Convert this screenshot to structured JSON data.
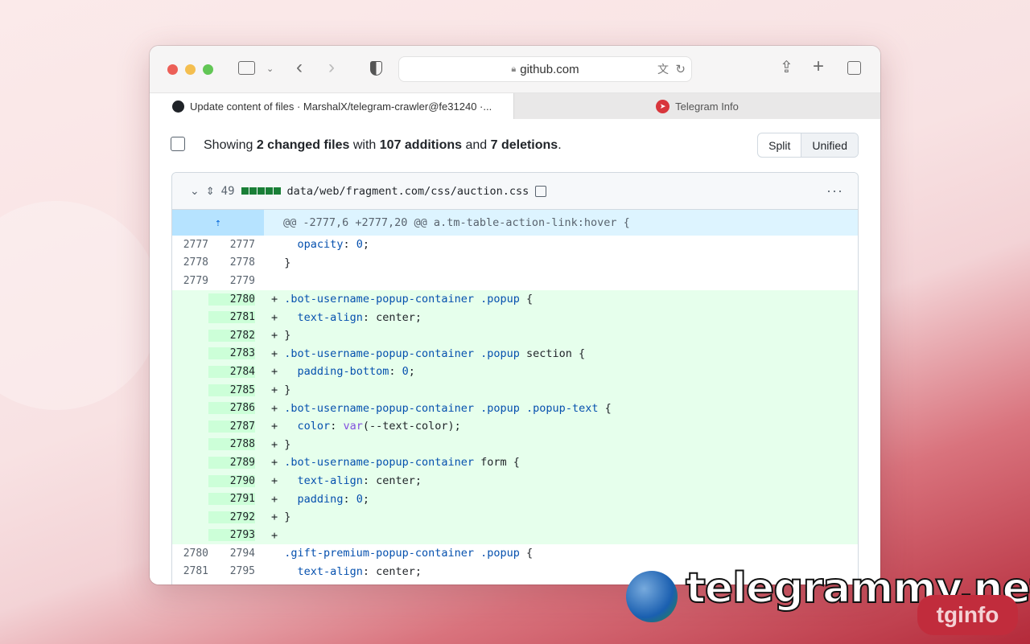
{
  "browser": {
    "url": "github.com",
    "tabs": [
      {
        "label": "Update content of files · MarshalX/telegram-crawler@fe31240 ·..."
      },
      {
        "label": "Telegram Info"
      }
    ]
  },
  "summary": {
    "prefix": "Showing ",
    "files": "2 changed files",
    "mid1": " with ",
    "additions": "107 additions",
    "mid2": " and ",
    "deletions": "7 deletions",
    "suffix": "."
  },
  "view_toggle": {
    "split": "Split",
    "unified": "Unified",
    "selected": "Unified"
  },
  "file": {
    "changes": "49",
    "path": "data/web/fragment.com/css/auction.css",
    "hunk": "@@ -2777,6 +2777,20 @@ a.tm-table-action-link:hover {"
  },
  "lines": [
    {
      "old": "2777",
      "new": "2777",
      "type": "ctx",
      "sign": " ",
      "tokens": [
        [
          "t",
          "  "
        ],
        [
          "p",
          "opacity"
        ],
        [
          "t",
          ": "
        ],
        [
          "n",
          "0"
        ],
        [
          "t",
          ";"
        ]
      ]
    },
    {
      "old": "2778",
      "new": "2778",
      "type": "ctx",
      "sign": " ",
      "tokens": [
        [
          "t",
          "}"
        ]
      ]
    },
    {
      "old": "2779",
      "new": "2779",
      "type": "ctx",
      "sign": " ",
      "tokens": []
    },
    {
      "old": "",
      "new": "2780",
      "type": "add",
      "sign": "+",
      "tokens": [
        [
          "s",
          ".bot-username-popup-container"
        ],
        [
          "t",
          " "
        ],
        [
          "s",
          ".popup"
        ],
        [
          "t",
          " {"
        ]
      ]
    },
    {
      "old": "",
      "new": "2781",
      "type": "add",
      "sign": "+",
      "tokens": [
        [
          "t",
          "  "
        ],
        [
          "p",
          "text-align"
        ],
        [
          "t",
          ": center;"
        ]
      ]
    },
    {
      "old": "",
      "new": "2782",
      "type": "add",
      "sign": "+",
      "tokens": [
        [
          "t",
          "}"
        ]
      ]
    },
    {
      "old": "",
      "new": "2783",
      "type": "add",
      "sign": "+",
      "tokens": [
        [
          "s",
          ".bot-username-popup-container"
        ],
        [
          "t",
          " "
        ],
        [
          "s",
          ".popup"
        ],
        [
          "t",
          " section {"
        ]
      ]
    },
    {
      "old": "",
      "new": "2784",
      "type": "add",
      "sign": "+",
      "tokens": [
        [
          "t",
          "  "
        ],
        [
          "p",
          "padding-bottom"
        ],
        [
          "t",
          ": "
        ],
        [
          "n",
          "0"
        ],
        [
          "t",
          ";"
        ]
      ]
    },
    {
      "old": "",
      "new": "2785",
      "type": "add",
      "sign": "+",
      "tokens": [
        [
          "t",
          "}"
        ]
      ]
    },
    {
      "old": "",
      "new": "2786",
      "type": "add",
      "sign": "+",
      "tokens": [
        [
          "s",
          ".bot-username-popup-container"
        ],
        [
          "t",
          " "
        ],
        [
          "s",
          ".popup"
        ],
        [
          "t",
          " "
        ],
        [
          "s",
          ".popup-text"
        ],
        [
          "t",
          " {"
        ]
      ]
    },
    {
      "old": "",
      "new": "2787",
      "type": "add",
      "sign": "+",
      "tokens": [
        [
          "t",
          "  "
        ],
        [
          "p",
          "color"
        ],
        [
          "t",
          ": "
        ],
        [
          "f",
          "var"
        ],
        [
          "t",
          "(--text-color);"
        ]
      ]
    },
    {
      "old": "",
      "new": "2788",
      "type": "add",
      "sign": "+",
      "tokens": [
        [
          "t",
          "}"
        ]
      ]
    },
    {
      "old": "",
      "new": "2789",
      "type": "add",
      "sign": "+",
      "tokens": [
        [
          "s",
          ".bot-username-popup-container"
        ],
        [
          "t",
          " form {"
        ]
      ]
    },
    {
      "old": "",
      "new": "2790",
      "type": "add",
      "sign": "+",
      "tokens": [
        [
          "t",
          "  "
        ],
        [
          "p",
          "text-align"
        ],
        [
          "t",
          ": center;"
        ]
      ]
    },
    {
      "old": "",
      "new": "2791",
      "type": "add",
      "sign": "+",
      "tokens": [
        [
          "t",
          "  "
        ],
        [
          "p",
          "padding"
        ],
        [
          "t",
          ": "
        ],
        [
          "n",
          "0"
        ],
        [
          "t",
          ";"
        ]
      ]
    },
    {
      "old": "",
      "new": "2792",
      "type": "add",
      "sign": "+",
      "tokens": [
        [
          "t",
          "}"
        ]
      ]
    },
    {
      "old": "",
      "new": "2793",
      "type": "add",
      "sign": "+",
      "tokens": []
    },
    {
      "old": "2780",
      "new": "2794",
      "type": "ctx",
      "sign": " ",
      "tokens": [
        [
          "s",
          ".gift-premium-popup-container"
        ],
        [
          "t",
          " "
        ],
        [
          "s",
          ".popup"
        ],
        [
          "t",
          " {"
        ]
      ]
    },
    {
      "old": "2781",
      "new": "2795",
      "type": "ctx",
      "sign": " ",
      "tokens": [
        [
          "t",
          "  "
        ],
        [
          "p",
          "text-align"
        ],
        [
          "t",
          ": center;"
        ]
      ]
    }
  ],
  "watermark": {
    "site": "telegrammy.net",
    "badge": "tginfo"
  }
}
